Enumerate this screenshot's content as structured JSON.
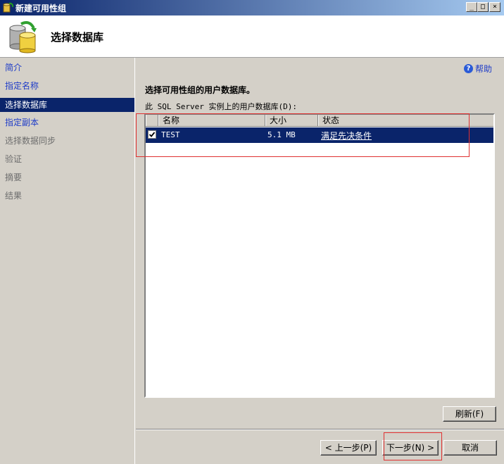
{
  "window": {
    "title": "新建可用性组"
  },
  "header": {
    "page_title": "选择数据库",
    "icon": "database-sync-icon"
  },
  "sidebar": {
    "items": [
      {
        "label": "简介",
        "state": "link"
      },
      {
        "label": "指定名称",
        "state": "link"
      },
      {
        "label": "选择数据库",
        "state": "active"
      },
      {
        "label": "指定副本",
        "state": "link"
      },
      {
        "label": "选择数据同步",
        "state": "disabled"
      },
      {
        "label": "验证",
        "state": "disabled"
      },
      {
        "label": "摘要",
        "state": "disabled"
      },
      {
        "label": "结果",
        "state": "disabled"
      }
    ]
  },
  "main": {
    "help_label": "帮助",
    "section_title": "选择可用性组的用户数据库。",
    "list_label": "此 SQL Server 实例上的用户数据库(D):",
    "columns": [
      "名称",
      "大小",
      "状态"
    ],
    "rows": [
      {
        "checked": true,
        "name": "TEST",
        "size": "5.1 MB",
        "status": "满足先决条件"
      }
    ],
    "refresh_label": "刷新(F)"
  },
  "footer": {
    "back_label": "< 上一步(P)",
    "next_label": "下一步(N) >",
    "cancel_label": "取消"
  },
  "colors": {
    "selection": "#0a246a",
    "link": "#1e3cc8",
    "annotation": "#e03030"
  }
}
